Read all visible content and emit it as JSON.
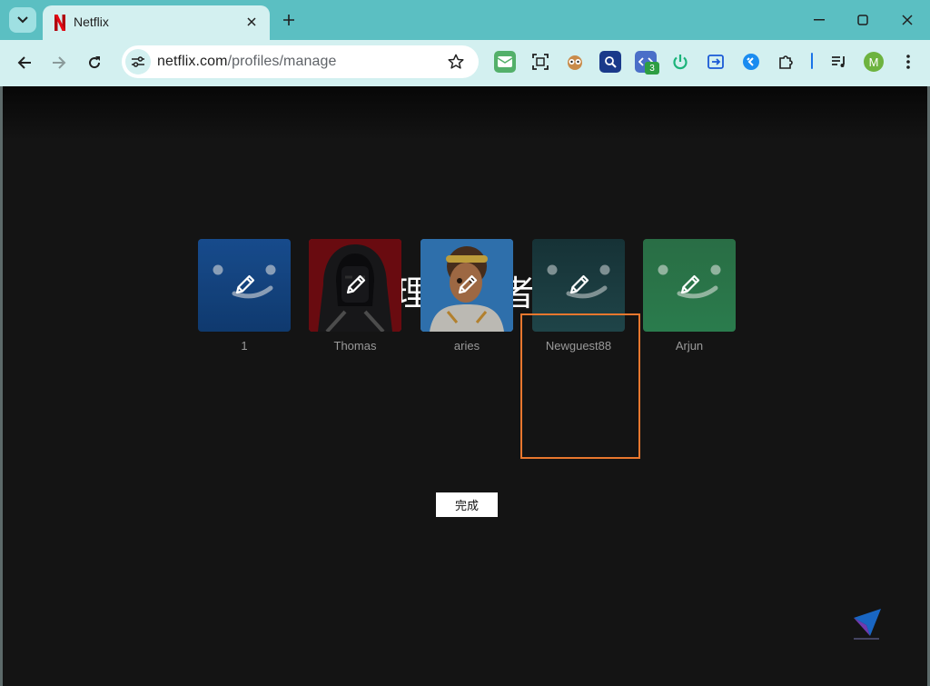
{
  "browser": {
    "tab": {
      "title": "Netflix"
    },
    "url": {
      "host": "netflix.com",
      "path": "/profiles/manage"
    },
    "extension_badge": "3",
    "avatar_letter": "M"
  },
  "page": {
    "heading": "管理使用者：",
    "profiles": [
      {
        "name": "1",
        "style": "blue-smiley"
      },
      {
        "name": "Thomas",
        "style": "hooded-figure"
      },
      {
        "name": "aries",
        "style": "animated-girl"
      },
      {
        "name": "Newguest88",
        "style": "teal-smiley"
      },
      {
        "name": "Arjun",
        "style": "green-smiley"
      }
    ],
    "done_button": "完成"
  },
  "colors": {
    "chrome": "#5bbfc2",
    "toolbar": "#d3f0f0",
    "page_bg": "#141414",
    "highlight": "#e8772e",
    "netflix_red": "#e50914"
  }
}
